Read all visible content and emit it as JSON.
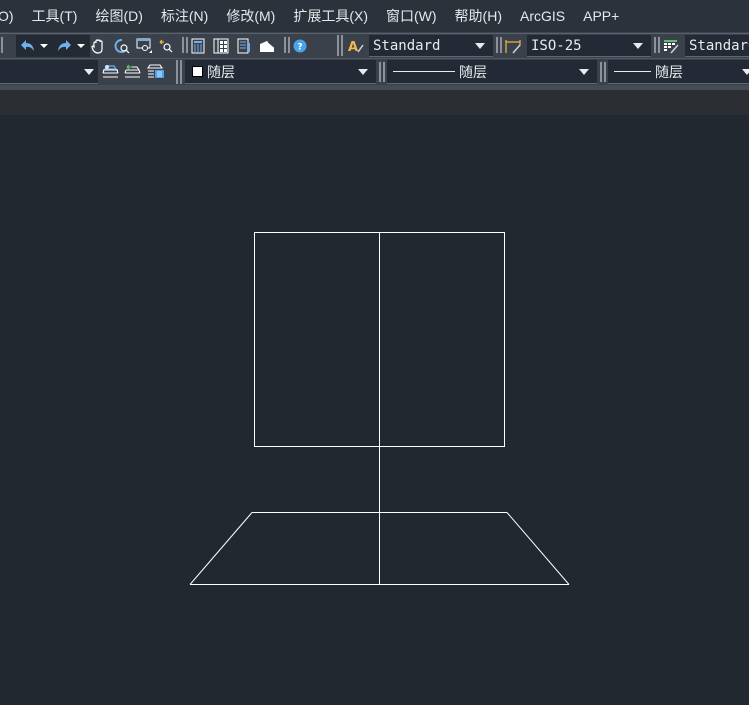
{
  "menubar": {
    "items": [
      {
        "label": "O)"
      },
      {
        "label": "工具(T)"
      },
      {
        "label": "绘图(D)"
      },
      {
        "label": "标注(N)"
      },
      {
        "label": "修改(M)"
      },
      {
        "label": "扩展工具(X)"
      },
      {
        "label": "窗口(W)"
      },
      {
        "label": "帮助(H)"
      },
      {
        "label": "ArcGIS"
      },
      {
        "label": "APP+"
      }
    ]
  },
  "toolbar_standard": {
    "icons": [
      {
        "name": "undo-icon"
      },
      {
        "name": "undo-dropdown-icon"
      },
      {
        "name": "redo-icon"
      },
      {
        "name": "redo-dropdown-icon"
      },
      {
        "name": "pan-hand-icon"
      },
      {
        "name": "zoom-realtime-icon"
      },
      {
        "name": "zoom-window-icon"
      },
      {
        "name": "zoom-previous-icon"
      },
      {
        "name": "properties-icon"
      },
      {
        "name": "design-center-icon"
      },
      {
        "name": "tool-palettes-icon"
      },
      {
        "name": "markup-set-icon"
      },
      {
        "name": "help-icon"
      }
    ]
  },
  "toolbar_styles": {
    "text_style": {
      "icon": "text-style-icon",
      "value": "Standard"
    },
    "dim_style": {
      "icon": "dimension-style-icon",
      "value": "ISO-25"
    },
    "table_style": {
      "icon": "table-style-icon",
      "value": "Standard"
    }
  },
  "toolbar_layers": {
    "layer_combo": {
      "value": ""
    },
    "layer_icons": [
      {
        "name": "layer-previous-icon"
      },
      {
        "name": "layer-make-current-icon"
      },
      {
        "name": "layer-states-icon"
      }
    ]
  },
  "toolbar_properties": {
    "color": {
      "value": "随层",
      "swatch": "#ffffff"
    },
    "linetype": {
      "value": "随层"
    },
    "lineweight": {
      "value": "随层"
    }
  },
  "canvas": {
    "background": "#212830",
    "line_color": "#ffffff",
    "entities": [
      {
        "type": "rectangle",
        "name": "rectangle-upper"
      },
      {
        "type": "line",
        "name": "vertical-center-line"
      },
      {
        "type": "line",
        "name": "trapezoid-top-edge"
      },
      {
        "type": "line",
        "name": "trapezoid-bottom-edge"
      },
      {
        "type": "line",
        "name": "trapezoid-left-edge"
      },
      {
        "type": "line",
        "name": "trapezoid-right-edge"
      }
    ]
  }
}
